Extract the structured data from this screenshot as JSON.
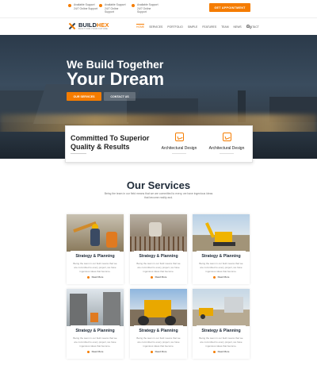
{
  "topbar": {
    "support": [
      {
        "line1": "Available Support",
        "line2": "24/7 Online Support"
      },
      {
        "line1": "Available Support",
        "line2": "24/7 Online",
        "line3": "Support"
      },
      {
        "line1": "Available Support",
        "line2": "24/7 Online",
        "line3": "Support"
      }
    ],
    "appointment_label": "GET APPOINTMENT"
  },
  "brand": {
    "name_a": "BUILD",
    "name_b": "HEX",
    "tagline": "BUILT FOR YOUR FUTURE"
  },
  "nav": {
    "items": [
      "HOME",
      "SERVICES",
      "PORTFOLIO",
      "SIMPLE",
      "FEATURES",
      "TEAM",
      "NEWS",
      "CONTACT"
    ],
    "active": 0
  },
  "hero": {
    "line1": "We Build Together",
    "line2": "Your Dream",
    "primary_button": "OUR SERVICES",
    "secondary_button": "CONTACT US"
  },
  "commit": {
    "title": "Committed To Superior Quality & Results",
    "features": [
      "Architectural Design",
      "Architectural Design"
    ]
  },
  "services": {
    "title": "Our Services",
    "subtitle": "Being the team in our field means that we are committed to every, we have ingenious ideas that become reality and.",
    "cards": [
      {
        "title": "Strategy & Planning",
        "text": "Being the team in our field means that we are committed to every project, we have ingenious ideas that become.",
        "more": "Read More",
        "scene": "workers"
      },
      {
        "title": "Strategy & Planning",
        "text": "Being the team in our field means that we are committed to every project, we have ingenious ideas that become.",
        "more": "Read More",
        "scene": "rebar"
      },
      {
        "title": "Strategy & Planning",
        "text": "Being the team in our field means that we are committed to every project, we have ingenious ideas that become.",
        "more": "Read More",
        "scene": "excavator"
      },
      {
        "title": "Strategy & Planning",
        "text": "Being the team in our field means that we are committed to every project, we have ingenious ideas that become.",
        "more": "Read More",
        "scene": "street"
      },
      {
        "title": "Strategy & Planning",
        "text": "Being the team in our field means that we are committed to every project, we have ingenious ideas that become.",
        "more": "Read More",
        "scene": "loader"
      },
      {
        "title": "Strategy & Planning",
        "text": "Being the team in our field means that we are committed to every project, we have ingenious ideas that become.",
        "more": "Read More",
        "scene": "site"
      }
    ]
  },
  "colors": {
    "accent": "#f57c00",
    "dark": "#1e2a38"
  }
}
